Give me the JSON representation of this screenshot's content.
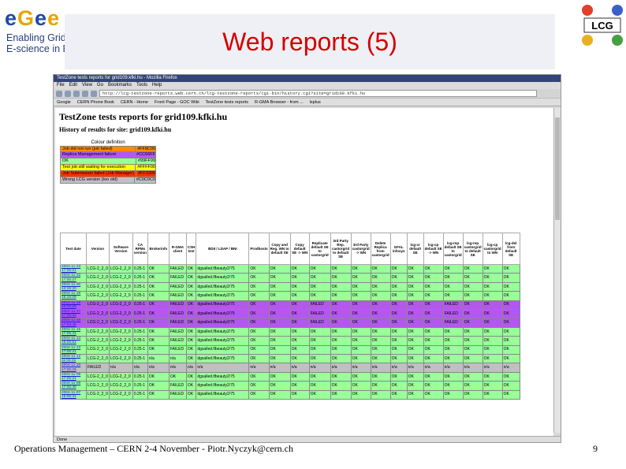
{
  "slide": {
    "title": "Web reports (5)",
    "footer": "Operations Management – CERN 2-4 November - Piotr.Nyczyk@cern.ch",
    "page_number": "9"
  },
  "logos": {
    "left_name": "egee",
    "left_lines": [
      "Enabling Grids f",
      "E-science in Euro"
    ],
    "right_name": "LCG"
  },
  "browser": {
    "window_title": "TestZone tests reports for grid109.kfki.hu - Mozilla Firefox",
    "menu": [
      "File",
      "Edit",
      "View",
      "Go",
      "Bookmarks",
      "Tools",
      "Help"
    ],
    "url": "http://lcg-testzone-reports.web.cern.ch/lcg-testzone-reports/cgi-bin/history.cgi?site=grid109.kfki.hu",
    "bookmarks": [
      "Google",
      "CERN Phone Book",
      "CERN - Home",
      "Front Page - GOC Wiki",
      "TestZone tests reports",
      "R-GMA Browser - from ...",
      "lxplus"
    ],
    "status": "Done"
  },
  "page": {
    "heading": "TestZone tests reports for grid109.kfki.hu",
    "subheading": "History of results for site: grid109.kfki.hu"
  },
  "legend": {
    "caption": "Colour definition",
    "items": [
      {
        "label": "Job did not run (job failed)",
        "hex": "#FF8C00",
        "color": "#ff8c00"
      },
      {
        "label": "Replica Management failure",
        "hex": "#CC66FF",
        "color": "#b357f0"
      },
      {
        "label": "OK",
        "hex": "#99FF99",
        "color": "#99ff99"
      },
      {
        "label": "Test job still waiting for execution",
        "hex": "#FFFF00",
        "color": "#ffff00"
      },
      {
        "label": "Job Submission failed (Job Manager)",
        "hex": "#FF3300",
        "color": "#ff3300"
      },
      {
        "label": "Wrong LCG version (too old)",
        "hex": "#C0C0C0",
        "color": "#c0c0c0"
      }
    ]
  },
  "table": {
    "headers": [
      "Test date",
      "Version",
      "Software Version",
      "CA RPMs version",
      "Brokerinfo",
      "R-GMA client",
      "CSH test",
      "BDII / LDAP / BNI",
      "Prodhosts",
      "Copy and Reg. WN to default SE",
      "Copy default SE -> WN",
      "Replicate default SE to castorgrid",
      "3rd Party Rep. castorgrid to default SE",
      "3rd Party castorgrid -> WN",
      "Delete Replica from castorgrid",
      "GFAL infosys",
      "lcg-cr default SE",
      "lcg-cp default SE -> WN",
      "lcg-rep default SE to castorgrid",
      "lcg-rep castorgrid to default SE",
      "lcg-cp castorgrid to WN",
      "lcg-del from default SE"
    ],
    "colors": {
      "ok": "#99ff99",
      "rm": "#b357f0",
      "old": "#c0c0c0"
    },
    "rows": [
      {
        "status": "ok",
        "cells": [
          "2004-11-23 17:05:21",
          "LCG-2_2_0",
          "LCG-2_2_0",
          "0.25-1",
          "OK",
          "FAILED",
          "OK",
          "dgsalled.lfbeauty2/75",
          "OK",
          "OK",
          "OK",
          "OK",
          "OK",
          "OK",
          "OK",
          "OK",
          "OK",
          "OK",
          "OK",
          "OK",
          "OK",
          "OK"
        ]
      },
      {
        "status": "ok",
        "cells": [
          "2004-11-22 17:05:27",
          "LCG-2_2_0",
          "LCG-2_2_0",
          "0.25-1",
          "OK",
          "FAILED",
          "OK",
          "dgsalled.lfbeauty2/75",
          "OK",
          "OK",
          "OK",
          "OK",
          "OK",
          "OK",
          "OK",
          "OK",
          "OK",
          "OK",
          "OK",
          "OK",
          "OK",
          "OK"
        ]
      },
      {
        "status": "ok",
        "cells": [
          "2004-11-20 14:15:20",
          "LCG-2_2_0",
          "LCG-2_2_0",
          "0.25-1",
          "OK",
          "FAILED",
          "OK",
          "dgsalled.lfbeauty2/75",
          "OK",
          "OK",
          "OK",
          "OK",
          "OK",
          "OK",
          "OK",
          "OK",
          "OK",
          "OK",
          "OK",
          "OK",
          "OK",
          "OK"
        ]
      },
      {
        "status": "ok",
        "cells": [
          "2004-11-19 16:16:09",
          "LCG-2_2_0",
          "LCG-2_2_0",
          "0.25-1",
          "OK",
          "FAILED",
          "OK",
          "dgsalled.lfbeauty2/75",
          "OK",
          "OK",
          "OK",
          "OK",
          "OK",
          "OK",
          "OK",
          "OK",
          "OK",
          "OK",
          "OK",
          "OK",
          "OK",
          "OK"
        ]
      },
      {
        "status": "rm",
        "cells": [
          "2004-11-18 16:05:29",
          "LCG-2_2_0",
          "LCG-2_2_0",
          "0.25-1",
          "OK",
          "FAILED",
          "OK",
          "dgsalled.lfbeauty2/75",
          "OK",
          "OK",
          "OK",
          "FAILED",
          "OK",
          "OK",
          "OK",
          "OK",
          "OK",
          "OK",
          "FAILED",
          "OK",
          "OK",
          "OK"
        ]
      },
      {
        "status": "rm",
        "cells": [
          "2004-11-17 17:05:33",
          "LCG-2_2_0",
          "LCG-2_2_0",
          "0.25-1",
          "OK",
          "FAILED",
          "OK",
          "dgsalled.lfbeauty2/75",
          "OK",
          "OK",
          "OK",
          "FAILED",
          "OK",
          "OK",
          "OK",
          "OK",
          "OK",
          "OK",
          "FAILED",
          "OK",
          "OK",
          "OK"
        ]
      },
      {
        "status": "rm",
        "cells": [
          "2004-11-16 17:05:48",
          "LCG-2_2_0",
          "LCG-2_2_0",
          "0.25-1",
          "OK",
          "FAILED",
          "OK",
          "dgsalled.lfbeauty2/75",
          "OK",
          "OK",
          "OK",
          "FAILED",
          "OK",
          "OK",
          "OK",
          "OK",
          "OK",
          "OK",
          "FAILED",
          "OK",
          "OK",
          "OK"
        ]
      },
      {
        "status": "ok",
        "cells": [
          "2004-11-15 17:05:41",
          "LCG-2_2_0",
          "LCG-2_2_0",
          "0.25-1",
          "OK",
          "FAILED",
          "OK",
          "dgsalled.lfbeauty2/75",
          "OK",
          "OK",
          "OK",
          "OK",
          "OK",
          "OK",
          "OK",
          "OK",
          "OK",
          "OK",
          "OK",
          "OK",
          "OK",
          "OK"
        ]
      },
      {
        "status": "ok",
        "cells": [
          "2004-11-14 15:05:51",
          "LCG-2_2_0",
          "LCG-2_2_0",
          "0.25-1",
          "OK",
          "FAILED",
          "OK",
          "dgsalled.lfbeauty2/75",
          "OK",
          "OK",
          "OK",
          "OK",
          "OK",
          "OK",
          "OK",
          "OK",
          "OK",
          "OK",
          "OK",
          "OK",
          "OK",
          "OK"
        ]
      },
      {
        "status": "ok",
        "cells": [
          "2004-11-13 17:05:21",
          "LCG-2_2_0",
          "LCG-2_2_0",
          "0.25-1",
          "OK",
          "FAILED",
          "OK",
          "dgsalled.lfbeauty2/75",
          "OK",
          "OK",
          "OK",
          "OK",
          "OK",
          "OK",
          "OK",
          "OK",
          "OK",
          "OK",
          "OK",
          "OK",
          "OK",
          "OK"
        ]
      },
      {
        "status": "ok",
        "cells": [
          "2004-11-12 11:02:31",
          "LCG-2_2_0",
          "LCG-2_2_0",
          "0.25-1",
          "n/a",
          "n/a",
          "OK",
          "dgsalled.lfbeauty2/75",
          "OK",
          "OK",
          "OK",
          "OK",
          "OK",
          "OK",
          "OK",
          "OK",
          "OK",
          "OK",
          "OK",
          "OK",
          "OK",
          "OK"
        ]
      },
      {
        "status": "old",
        "cells": [
          "2004-11-10 17:05:29",
          "FAILED",
          "n/a",
          "n/a",
          "n/a",
          "n/a",
          "n/a",
          "n/a",
          "n/a",
          "n/a",
          "n/a",
          "n/a",
          "n/a",
          "n/a",
          "n/a",
          "n/a",
          "n/a",
          "n/a",
          "n/a",
          "n/a",
          "n/a",
          "n/a"
        ]
      },
      {
        "status": "ok",
        "cells": [
          "2004-11-09 17:05:21",
          "LCG-2_2_0",
          "LCG-2_2_0",
          "0.25-1",
          "OK",
          "OK",
          "OK",
          "dgsalled.lfbeauty2/75",
          "OK",
          "OK",
          "OK",
          "OK",
          "OK",
          "OK",
          "OK",
          "OK",
          "OK",
          "OK",
          "OK",
          "OK",
          "OK",
          "OK"
        ]
      },
      {
        "status": "ok",
        "cells": [
          "2004-11-08 17:05:39",
          "LCG-2_2_0",
          "LCG-2_2_0",
          "0.25-1",
          "OK",
          "FAILED",
          "OK",
          "dgsalled.lfbeauty2/75",
          "OK",
          "OK",
          "OK",
          "OK",
          "OK",
          "OK",
          "OK",
          "OK",
          "OK",
          "OK",
          "OK",
          "OK",
          "OK",
          "OK"
        ]
      },
      {
        "status": "ok",
        "cells": [
          "2004-11-07 15:05:31",
          "LCG-2_2_0",
          "LCG-2_2_0",
          "0.25-1",
          "OK",
          "FAILED",
          "OK",
          "dgsalled.lfbeauty2/75",
          "OK",
          "OK",
          "OK",
          "OK",
          "OK",
          "OK",
          "OK",
          "OK",
          "OK",
          "OK",
          "OK",
          "OK",
          "OK",
          "OK"
        ]
      }
    ]
  }
}
